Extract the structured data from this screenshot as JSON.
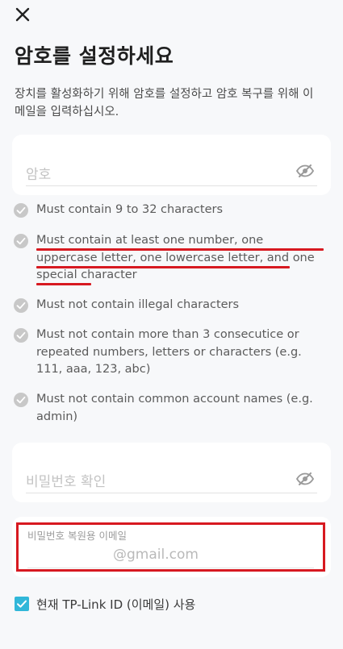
{
  "header": {
    "title": "암호를 설정하세요",
    "description": "장치를 활성화하기 위해 암호를 설정하고 암호 복구를 위해 이메일을 입력하십시오."
  },
  "password_field": {
    "placeholder": "암호",
    "eye_icon": "eye-off-icon"
  },
  "rules": [
    {
      "text": "Must contain 9 to 32 characters",
      "status": "check",
      "highlighted": false
    },
    {
      "text": "Must contain at least one number, one uppercase letter, one lowercase letter, and one special character",
      "status": "check",
      "highlighted": true
    },
    {
      "text": "Must not contain illegal characters",
      "status": "check",
      "highlighted": false
    },
    {
      "text": "Must not contain more than 3 consecutice or repeated numbers, letters or characters (e.g. 111, aaa, 123, abc)",
      "status": "check",
      "highlighted": false
    },
    {
      "text": "Must not contain common account names (e.g. admin)",
      "status": "check",
      "highlighted": false
    }
  ],
  "confirm_field": {
    "placeholder": "비밀번호 확인",
    "eye_icon": "eye-off-icon"
  },
  "email_field": {
    "label": "비밀번호 복원용 이메일",
    "suffix": "@gmail.com"
  },
  "use_tplink_id": {
    "label": "현재 TP-Link ID (이메일) 사용",
    "checked": true
  },
  "colors": {
    "accent": "#31b7d9",
    "highlight": "#d71920",
    "check_gray": "#c8c8c8"
  }
}
